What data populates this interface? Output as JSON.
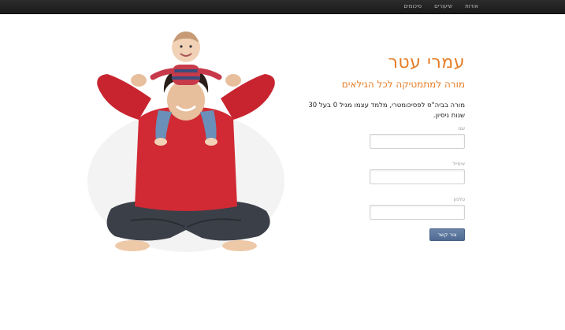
{
  "nav": {
    "items": [
      {
        "label": "אודות"
      },
      {
        "label": "שיעורים"
      },
      {
        "label": "סיכומים"
      }
    ]
  },
  "hero": {
    "name": "עמרי עטר",
    "subtitle": "מורה למתמטיקה לכל הגילאים",
    "description": "מורה בביה\"ס לפסיכומטרי, מלמד עצמו מגיל 0 בעל 30 שנות ניסיון."
  },
  "form": {
    "name_label": "שם",
    "email_label": "אימייל",
    "phone_label": "טלפון",
    "name_value": "",
    "email_value": "",
    "phone_value": "",
    "submit_label": "צור קשר"
  },
  "colors": {
    "accent": "#e57d27",
    "topbar": "#222222",
    "button": "#5b7499"
  }
}
